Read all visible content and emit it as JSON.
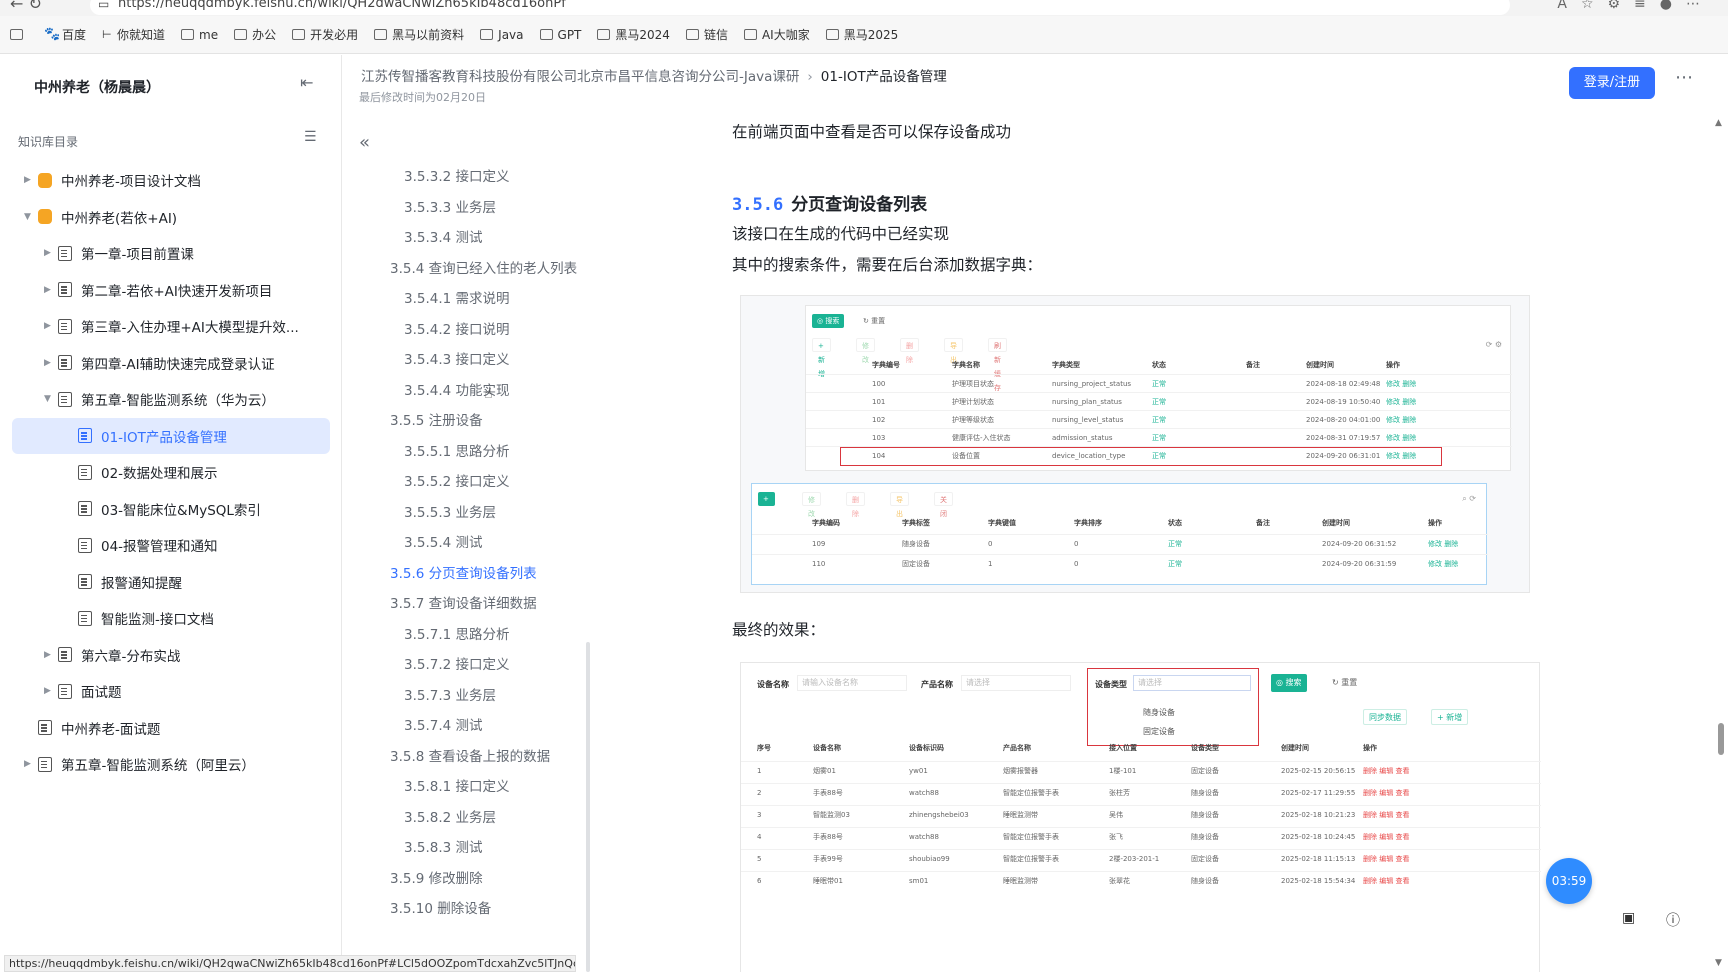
{
  "browser": {
    "url": "https://heuqqdmbyk.feishu.cn/wiki/QH2dwaCNwiZh65kIb48cd16onPf",
    "bookmarks": [
      "百度",
      "你就知道",
      "me",
      "办公",
      "开发必用",
      "黑马以前资料",
      "Java",
      "GPT",
      "黑马2024",
      "链信",
      "AI大咖家",
      "黑马2025"
    ]
  },
  "sidebar": {
    "title": "中州养老（杨晨晨）",
    "dir_label": "知识库目录",
    "items": [
      {
        "label": "中州养老-项目设计文档",
        "level": 0,
        "icon": "orange",
        "arrow": "right"
      },
      {
        "label": "中州养老(若依+AI)",
        "level": 0,
        "icon": "orange",
        "arrow": "down"
      },
      {
        "label": "第一章-项目前置课",
        "level": 1,
        "icon": "doc",
        "arrow": "right"
      },
      {
        "label": "第二章-若依+AI快速开发新项目",
        "level": 1,
        "icon": "doc",
        "arrow": "right"
      },
      {
        "label": "第三章-入住办理+AI大模型提升效...",
        "level": 1,
        "icon": "doc",
        "arrow": "right"
      },
      {
        "label": "第四章-AI辅助快速完成登录认证",
        "level": 1,
        "icon": "doc",
        "arrow": "right"
      },
      {
        "label": "第五章-智能监测系统（华为云）",
        "level": 1,
        "icon": "doc",
        "arrow": "down"
      },
      {
        "label": "01-IOT产品设备管理",
        "level": 2,
        "icon": "blue",
        "arrow": "",
        "active": true
      },
      {
        "label": "02-数据处理和展示",
        "level": 2,
        "icon": "doc",
        "arrow": ""
      },
      {
        "label": "03-智能床位&MySQL索引",
        "level": 2,
        "icon": "doc",
        "arrow": ""
      },
      {
        "label": "04-报警管理和通知",
        "level": 2,
        "icon": "doc",
        "arrow": ""
      },
      {
        "label": "报警通知提醒",
        "level": 2,
        "icon": "doc",
        "arrow": ""
      },
      {
        "label": "智能监测-接口文档",
        "level": 2,
        "icon": "doc",
        "arrow": ""
      },
      {
        "label": "第六章-分布实战",
        "level": 1,
        "icon": "doc",
        "arrow": "right"
      },
      {
        "label": "面试题",
        "level": 1,
        "icon": "doc",
        "arrow": "right"
      },
      {
        "label": "中州养老-面试题",
        "level": 0,
        "icon": "doc",
        "arrow": ""
      },
      {
        "label": "第五章-智能监测系统（阿里云）",
        "level": 0,
        "icon": "doc",
        "arrow": "right"
      }
    ]
  },
  "header": {
    "breadcrumb_parent": "江苏传智播客教育科技股份有限公司北京市昌平信息咨询分公司-Java课研",
    "breadcrumb_current": "01-IOT产品设备管理",
    "updated": "最后修改时间为02月20日",
    "login_label": "登录/注册"
  },
  "outline": [
    {
      "label": "3.5.3.2 接口定义",
      "level": 3
    },
    {
      "label": "3.5.3.3 业务层",
      "level": 3
    },
    {
      "label": "3.5.3.4 测试",
      "level": 3
    },
    {
      "label": "3.5.4 查询已经入住的老人列表",
      "level": 2
    },
    {
      "label": "3.5.4.1 需求说明",
      "level": 3
    },
    {
      "label": "3.5.4.2 接口说明",
      "level": 3
    },
    {
      "label": "3.5.4.3 接口定义",
      "level": 3
    },
    {
      "label": "3.5.4.4 功能实现",
      "level": 3
    },
    {
      "label": "3.5.5 注册设备",
      "level": 2
    },
    {
      "label": "3.5.5.1 思路分析",
      "level": 3
    },
    {
      "label": "3.5.5.2 接口定义",
      "level": 3
    },
    {
      "label": "3.5.5.3 业务层",
      "level": 3
    },
    {
      "label": "3.5.5.4 测试",
      "level": 3
    },
    {
      "label": "3.5.6 分页查询设备列表",
      "level": 2,
      "active": true
    },
    {
      "label": "3.5.7 查询设备详细数据",
      "level": 2
    },
    {
      "label": "3.5.7.1 思路分析",
      "level": 3
    },
    {
      "label": "3.5.7.2 接口定义",
      "level": 3
    },
    {
      "label": "3.5.7.3 业务层",
      "level": 3
    },
    {
      "label": "3.5.7.4 测试",
      "level": 3
    },
    {
      "label": "3.5.8 查看设备上报的数据",
      "level": 2
    },
    {
      "label": "3.5.8.1 接口定义",
      "level": 3
    },
    {
      "label": "3.5.8.2 业务层",
      "level": 3
    },
    {
      "label": "3.5.8.3 测试",
      "level": 3
    },
    {
      "label": "3.5.9 修改删除",
      "level": 2
    },
    {
      "label": "3.5.10 删除设备",
      "level": 2
    }
  ],
  "doc": {
    "p1": "在前端页面中查看是否可以保存设备成功",
    "h3_num": "3.5.6",
    "h3_text": "分页查询设备列表",
    "p2": "该接口在生成的代码中已经实现",
    "p3": "其中的搜索条件，需要在后台添加数据字典：",
    "p4": "最终的效果：",
    "shot1": {
      "btn_search": "搜索",
      "btn_reset": "重置",
      "toolbar": [
        "+ 新增",
        "修改",
        "删除",
        "导出",
        "刷新缓存"
      ],
      "headers": [
        "字典编号",
        "字典名称",
        "字典类型",
        "状态",
        "备注",
        "创建时间",
        "操作"
      ],
      "rows": [
        [
          "100",
          "护理项目状态",
          "nursing_project_status",
          "正常",
          "",
          "2024-08-18 02:49:48",
          "修改  删除"
        ],
        [
          "101",
          "护理计划状态",
          "nursing_plan_status",
          "正常",
          "",
          "2024-08-19 10:50:40",
          "修改  删除"
        ],
        [
          "102",
          "护理等级状态",
          "nursing_level_status",
          "正常",
          "",
          "2024-08-20 04:01:00",
          "修改  删除"
        ],
        [
          "103",
          "健康评估-入住状态",
          "admission_status",
          "正常",
          "",
          "2024-08-31 07:19:57",
          "修改  删除"
        ],
        [
          "104",
          "设备位置",
          "device_location_type",
          "正常",
          "",
          "2024-09-20 06:31:01",
          "修改  删除"
        ]
      ]
    },
    "shot2": {
      "toolbar": [
        "+ 新增",
        "修改",
        "删除",
        "导出",
        "关闭"
      ],
      "headers": [
        "字典编码",
        "字典标签",
        "字典键值",
        "字典排序",
        "状态",
        "备注",
        "创建时间",
        "操作"
      ],
      "rows": [
        [
          "109",
          "随身设备",
          "0",
          "0",
          "正常",
          "",
          "2024-09-20 06:31:52",
          "修改  删除"
        ],
        [
          "110",
          "固定设备",
          "1",
          "0",
          "正常",
          "",
          "2024-09-20 06:31:59",
          "修改  删除"
        ]
      ]
    },
    "shot3": {
      "labels": {
        "device_name": "设备名称",
        "product_name": "产品名称",
        "device_type": "设备类型"
      },
      "placeholders": {
        "device_name": "请输入设备名称",
        "product_name": "请选择",
        "device_type": "请选择"
      },
      "dropdown": [
        "随身设备",
        "固定设备"
      ],
      "btn_search": "搜索",
      "btn_reset": "重置",
      "btn_sync": "同步数据",
      "btn_add": "+ 新增",
      "headers": [
        "序号",
        "设备名称",
        "设备标识码",
        "产品名称",
        "接入位置",
        "设备类型",
        "创建时间",
        "操作"
      ],
      "rows": [
        [
          "1",
          "烟雾01",
          "yw01",
          "烟雾报警器",
          "1楼-101",
          "固定设备",
          "2025-02-15 20:56:15",
          "删除  编辑  查看"
        ],
        [
          "2",
          "手表88号",
          "watch88",
          "智能定位报警手表",
          "张柱芳",
          "随身设备",
          "2025-02-17 11:29:55",
          "删除  编辑  查看"
        ],
        [
          "3",
          "智能监测03",
          "zhinengshebei03",
          "睡眠监测带",
          "吴伟",
          "随身设备",
          "2025-02-18 10:21:23",
          "删除  编辑  查看"
        ],
        [
          "4",
          "手表88号",
          "watch88",
          "智能定位报警手表",
          "张飞",
          "随身设备",
          "2025-02-18 10:24:45",
          "删除  编辑  查看"
        ],
        [
          "5",
          "手表99号",
          "shoubiao99",
          "智能定位报警手表",
          "2楼-203-201-1",
          "固定设备",
          "2025-02-18 11:15:13",
          "删除  编辑  查看"
        ],
        [
          "6",
          "睡眠带01",
          "sm01",
          "睡眠监测带",
          "张翠花",
          "随身设备",
          "2025-02-18 15:54:34",
          "删除  编辑  查看"
        ]
      ]
    }
  },
  "status_url": "https://heuqqdmbyk.feishu.cn/wiki/QH2qwaCNwiZh65kIb48cd16onPf#LCl5dOOZpomTdcxahZvc5lTJnQc",
  "timer": "03:59",
  "colors": {
    "accent": "#3370ff",
    "green": "#1ab394",
    "red_outline": "#d9363e"
  }
}
